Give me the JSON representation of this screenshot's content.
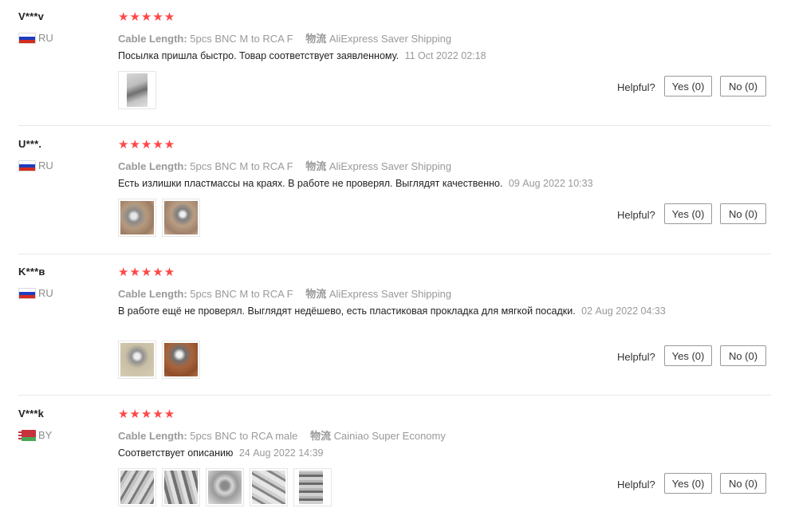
{
  "helpful_label": "Helpful?",
  "reviews": [
    {
      "user": "V***v",
      "country": "RU",
      "stars": "★★★★★",
      "sku_key": "Cable Length:",
      "sku_val": "5pcs BNC M to RCA F",
      "ship_key": "物流",
      "ship_val": "AliExpress Saver Shipping",
      "text": "Посылка пришла быстро. Товар соответствует заявленному.",
      "date": "11 Oct 2022 02:18",
      "yes": "Yes (0)",
      "no": "No (0)"
    },
    {
      "user": "U***.",
      "country": "RU",
      "stars": "★★★★★",
      "sku_key": "Cable Length:",
      "sku_val": "5pcs BNC M to RCA F",
      "ship_key": "物流",
      "ship_val": "AliExpress Saver Shipping",
      "text": "Есть излишки пластмассы на краях. В работе не проверял. Выглядят качественно.",
      "date": "09 Aug 2022 10:33",
      "yes": "Yes (0)",
      "no": "No (0)"
    },
    {
      "user": "K***в",
      "country": "RU",
      "stars": "★★★★★",
      "sku_key": "Cable Length:",
      "sku_val": "5pcs BNC M to RCA F",
      "ship_key": "物流",
      "ship_val": "AliExpress Saver Shipping",
      "text": "В работе ещё не проверял. Выглядят недёшево, есть пластиковая прокладка для мягкой посадки.",
      "date": "02 Aug 2022 04:33",
      "yes": "Yes (0)",
      "no": "No (0)"
    },
    {
      "user": "V***k",
      "country": "BY",
      "stars": "★★★★★",
      "sku_key": "Cable Length:",
      "sku_val": "5pcs BNC to RCA male",
      "ship_key": "物流",
      "ship_val": "Cainiao Super Economy",
      "text": "Соответствует описанию",
      "date": "24 Aug 2022 14:39",
      "yes": "Yes (0)",
      "no": "No (0)"
    }
  ],
  "colors": {
    "star": "#ff4747",
    "flag_ru": [
      "#ffffff",
      "#1c3dbf",
      "#d52b1e"
    ],
    "flag_by": [
      "#c8313e",
      "#4aa657"
    ]
  }
}
